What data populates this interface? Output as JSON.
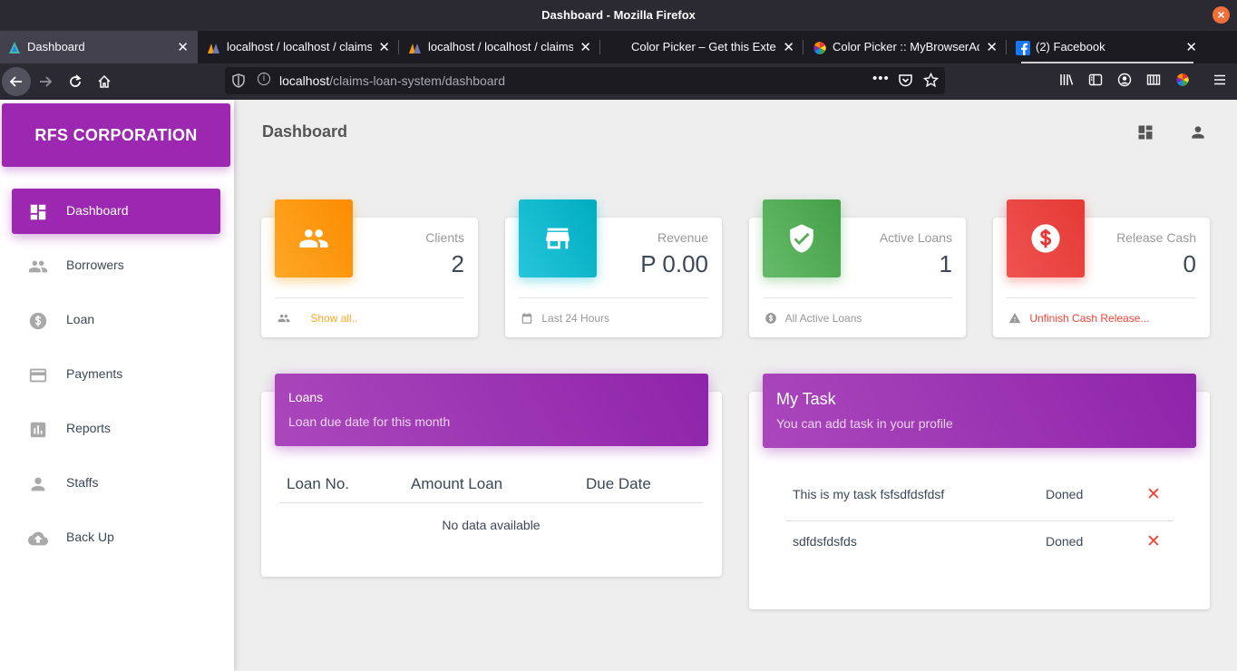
{
  "window": {
    "title": "Dashboard - Mozilla Firefox"
  },
  "tabs": [
    {
      "label": "Dashboard",
      "icon": "app-icon",
      "active": true
    },
    {
      "label": "localhost / localhost / claims",
      "icon": "phpmyadmin-icon",
      "active": false
    },
    {
      "label": "localhost / localhost / claims",
      "icon": "phpmyadmin-icon",
      "active": false
    },
    {
      "label": "Color Picker – Get this Extension",
      "icon": "",
      "active": false
    },
    {
      "label": "Color Picker :: MyBrowserAddon",
      "icon": "color-wheel-icon",
      "active": false
    },
    {
      "label": "(2) Facebook",
      "icon": "facebook-icon",
      "active": false
    }
  ],
  "urlbar": {
    "host": "localhost",
    "path": "/claims-loan-system/dashboard"
  },
  "sidebar": {
    "brand": "RFS CORPORATION",
    "items": [
      {
        "label": "Dashboard",
        "icon": "dashboard-icon",
        "active": true
      },
      {
        "label": "Borrowers",
        "icon": "people-icon",
        "active": false
      },
      {
        "label": "Loan",
        "icon": "dollar-icon",
        "active": false
      },
      {
        "label": "Payments",
        "icon": "credit-card-icon",
        "active": false
      },
      {
        "label": "Reports",
        "icon": "bar-chart-icon",
        "active": false
      },
      {
        "label": "Staffs",
        "icon": "person-icon",
        "active": false
      },
      {
        "label": "Back Up",
        "icon": "cloud-upload-icon",
        "active": false
      }
    ]
  },
  "main": {
    "title": "Dashboard",
    "top_icons": [
      "dashboard-icon",
      "person-icon"
    ]
  },
  "stats": [
    {
      "title": "Clients",
      "value": "2",
      "footer": "Show all..",
      "footer_icon": "people-icon",
      "color": "#fb8c00",
      "footer_color": "#ffa726"
    },
    {
      "title": "Revenue",
      "value": "P 0.00",
      "footer": "Last 24 Hours",
      "footer_icon": "calendar-icon",
      "color": "#00acc1",
      "footer_color": "#999999"
    },
    {
      "title": "Active Loans",
      "value": "1",
      "footer": "All Active Loans",
      "footer_icon": "dollar-icon",
      "color": "#43a047",
      "footer_color": "#999999"
    },
    {
      "title": "Release Cash",
      "value": "0",
      "footer": "Unfinish Cash Release...",
      "footer_icon": "warning-icon",
      "color": "#e53935",
      "footer_color": "#f44336"
    }
  ],
  "loans": {
    "title": "Loans",
    "subtitle": "Loan due date for this month",
    "columns": [
      "Loan No.",
      "Amount Loan",
      "Due Date"
    ],
    "empty": "No data available"
  },
  "tasks": {
    "title": "My Task",
    "subtitle": "You can add task in your profile",
    "rows": [
      {
        "text": "This is my task fsfsdfdsfdsf",
        "status": "Doned"
      },
      {
        "text": "sdfdsfdsfds",
        "status": "Doned"
      }
    ],
    "delete_glyph": "✕"
  },
  "colors": {
    "primary": "#9c27b0",
    "danger": "#f44336"
  }
}
